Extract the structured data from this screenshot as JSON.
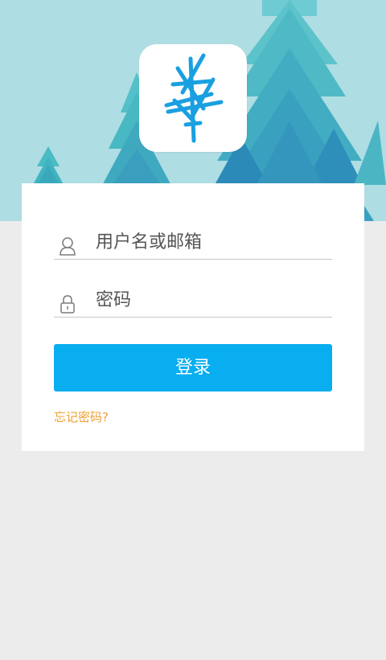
{
  "login_form": {
    "username_placeholder": "用户名或邮箱",
    "password_placeholder": "密码",
    "login_button_label": "登录",
    "forgot_password_label": "忘记密码?"
  },
  "icons": {
    "logo": "tree-logo-icon",
    "username": "user-icon",
    "password": "lock-icon"
  },
  "colors": {
    "sky": "#aedde3",
    "page_background": "#ececec",
    "tree_light": "#6fcbd3",
    "tree_mid": "#3fb3c0",
    "tree_dark": "#3a9ebf",
    "tree_darker": "#2b8ab8",
    "login_button": "#08aef0",
    "forgot_link": "#f0a033",
    "logo_stroke": "#1aa0e0"
  }
}
